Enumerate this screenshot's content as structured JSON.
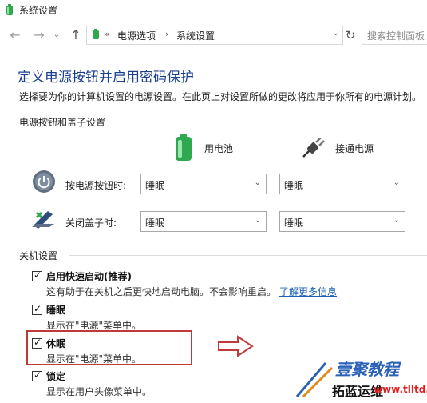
{
  "window": {
    "title": "系统设置"
  },
  "navigation": {
    "back_icon": "arrow-left-icon",
    "forward_icon": "arrow-right-icon",
    "recent_icon": "chevron-down-icon",
    "up_icon": "arrow-up-icon",
    "address": {
      "overflow_glyph": "«",
      "crumbs": [
        "电源选项",
        "系统设置"
      ],
      "separator": "›"
    },
    "refresh_icon": "refresh-icon",
    "search_placeholder": "搜索控制面板"
  },
  "page": {
    "title": "定义电源按钮并启用密码保护",
    "intro": "选择要为你的计算机设置的电源设置。在此页上对设置所做的更改将应用于你所有的电源计划。"
  },
  "power_section": {
    "heading": "电源按钮和盖子设置",
    "columns": [
      {
        "label": "用电池",
        "icon": "battery-icon"
      },
      {
        "label": "接通电源",
        "icon": "power-plug-icon"
      }
    ],
    "rows": [
      {
        "label": "按电源按钮时:",
        "icon": "power-button-icon",
        "battery": "睡眠",
        "plugged_in": "睡眠"
      },
      {
        "label": "关闭盖子时:",
        "icon": "laptop-lid-icon",
        "battery": "睡眠",
        "plugged_in": "睡眠"
      }
    ]
  },
  "shutdown_section": {
    "heading": "关机设置",
    "options": [
      {
        "title": "启用快速启动(推荐)",
        "description": "这有助于在关机之后更快地启动电脑。不会影响重启。",
        "link": "了解更多信息",
        "checked": true
      },
      {
        "title": "睡眠",
        "description": "显示在\"电源\"菜单中。",
        "checked": true
      },
      {
        "title": "休眠",
        "description": "显示在\"电源\"菜单中。",
        "checked": true
      },
      {
        "title": "锁定",
        "description": "显示在用户头像菜单中。",
        "checked": true
      }
    ]
  },
  "annotation": {
    "highlight_color": "#c03a3a",
    "arrow_icon": "hollow-arrow-right-icon"
  },
  "watermark": {
    "line1": "壹聚教程",
    "line2": "拓蓝运维",
    "line3": "www.tlltd.cn"
  },
  "colors": {
    "title": "#1a3f8c",
    "link": "#1a5fb4",
    "battery": "#2fa84f"
  }
}
